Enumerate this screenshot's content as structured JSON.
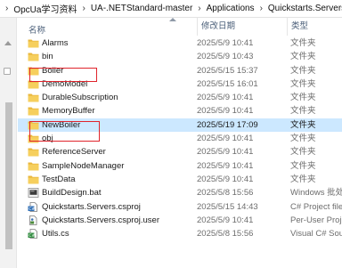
{
  "breadcrumb": [
    "OpcUa学习资料",
    "UA-.NETStandard-master",
    "Applications",
    "Quickstarts.Servers"
  ],
  "columns": {
    "name": "名称",
    "date": "修改日期",
    "type": "类型"
  },
  "rows": [
    {
      "name": "Alarms",
      "date": "2025/5/9 10:41",
      "type": "文件夹",
      "icon": "folder-icon"
    },
    {
      "name": "bin",
      "date": "2025/5/9 10:43",
      "type": "文件夹",
      "icon": "folder-icon"
    },
    {
      "name": "Boiler",
      "date": "2025/5/15 15:37",
      "type": "文件夹",
      "icon": "folder-icon"
    },
    {
      "name": "DemoModel",
      "date": "2025/5/15 16:01",
      "type": "文件夹",
      "icon": "folder-icon"
    },
    {
      "name": "DurableSubscription",
      "date": "2025/5/9 10:41",
      "type": "文件夹",
      "icon": "folder-icon"
    },
    {
      "name": "MemoryBuffer",
      "date": "2025/5/9 10:41",
      "type": "文件夹",
      "icon": "folder-icon"
    },
    {
      "name": "NewBoiler",
      "date": "2025/5/19 17:09",
      "type": "文件夹",
      "icon": "folder-icon"
    },
    {
      "name": "obj",
      "date": "2025/5/9 10:41",
      "type": "文件夹",
      "icon": "folder-icon"
    },
    {
      "name": "ReferenceServer",
      "date": "2025/5/9 10:41",
      "type": "文件夹",
      "icon": "folder-icon"
    },
    {
      "name": "SampleNodeManager",
      "date": "2025/5/9 10:41",
      "type": "文件夹",
      "icon": "folder-icon"
    },
    {
      "name": "TestData",
      "date": "2025/5/9 10:41",
      "type": "文件夹",
      "icon": "folder-icon"
    },
    {
      "name": "BuildDesign.bat",
      "date": "2025/5/8 15:56",
      "type": "Windows 批处",
      "icon": "batch-file-icon"
    },
    {
      "name": "Quickstarts.Servers.csproj",
      "date": "2025/5/15 14:43",
      "type": "C# Project file",
      "icon": "csproj-file-icon"
    },
    {
      "name": "Quickstarts.Servers.csproj.user",
      "date": "2025/5/9 10:41",
      "type": "Per-User Proj",
      "icon": "user-file-icon"
    },
    {
      "name": "Utils.cs",
      "date": "2025/5/8 15:56",
      "type": "Visual C# Sou",
      "icon": "cs-file-icon"
    }
  ],
  "selected_index": 6,
  "colors": {
    "selection": "#cce8ff",
    "highlight_box": "#e0242c",
    "folder": "#f3c64b"
  }
}
